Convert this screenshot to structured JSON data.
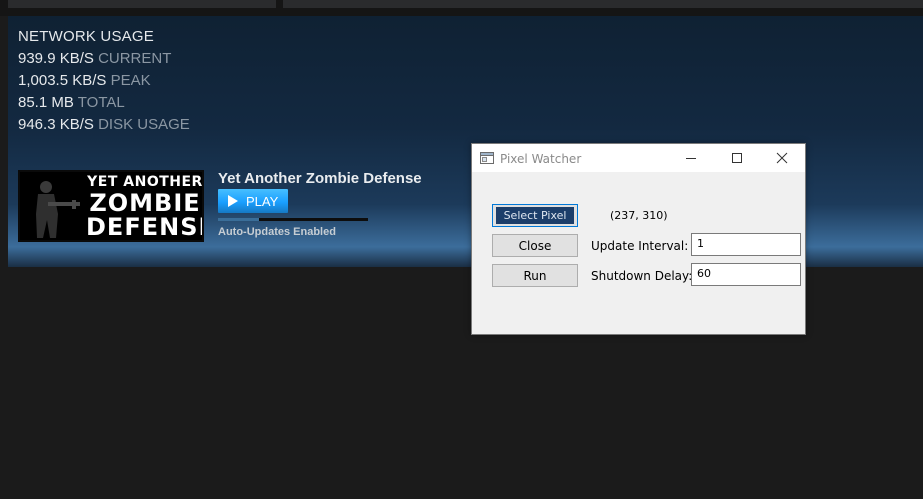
{
  "network": {
    "title": "NETWORK USAGE",
    "rows": [
      {
        "value": "939.9 KB/S",
        "label": "CURRENT"
      },
      {
        "value": "1,003.5 KB/S",
        "label": "PEAK"
      },
      {
        "value": "85.1 MB",
        "label": "TOTAL"
      },
      {
        "value": "946.3 KB/S",
        "label": "DISK USAGE"
      }
    ]
  },
  "game": {
    "title": "Yet Another Zombie Defense",
    "logo_lines": [
      "YET ANOTHER",
      "ZOMBIE",
      "DEFENSE"
    ],
    "play_label": "PLAY",
    "progress": 0.27,
    "status": "Auto-Updates Enabled"
  },
  "dialog": {
    "title": "Pixel Watcher",
    "select_pixel_label": "Select Pixel",
    "close_label": "Close",
    "run_label": "Run",
    "coords": "(237, 310)",
    "update_interval_label": "Update Interval:",
    "update_interval_value": "1",
    "shutdown_delay_label": "Shutdown Delay:",
    "shutdown_delay_value": "60"
  },
  "colors": {
    "play_accent": "#1a9fff",
    "progress_fill": "#3a6e99",
    "focused_button": "#1c3e6a"
  },
  "icons": {
    "play": "play-triangle-icon",
    "app": "window-app-icon",
    "minimize": "minimize-icon",
    "maximize": "maximize-icon",
    "close": "close-icon"
  }
}
